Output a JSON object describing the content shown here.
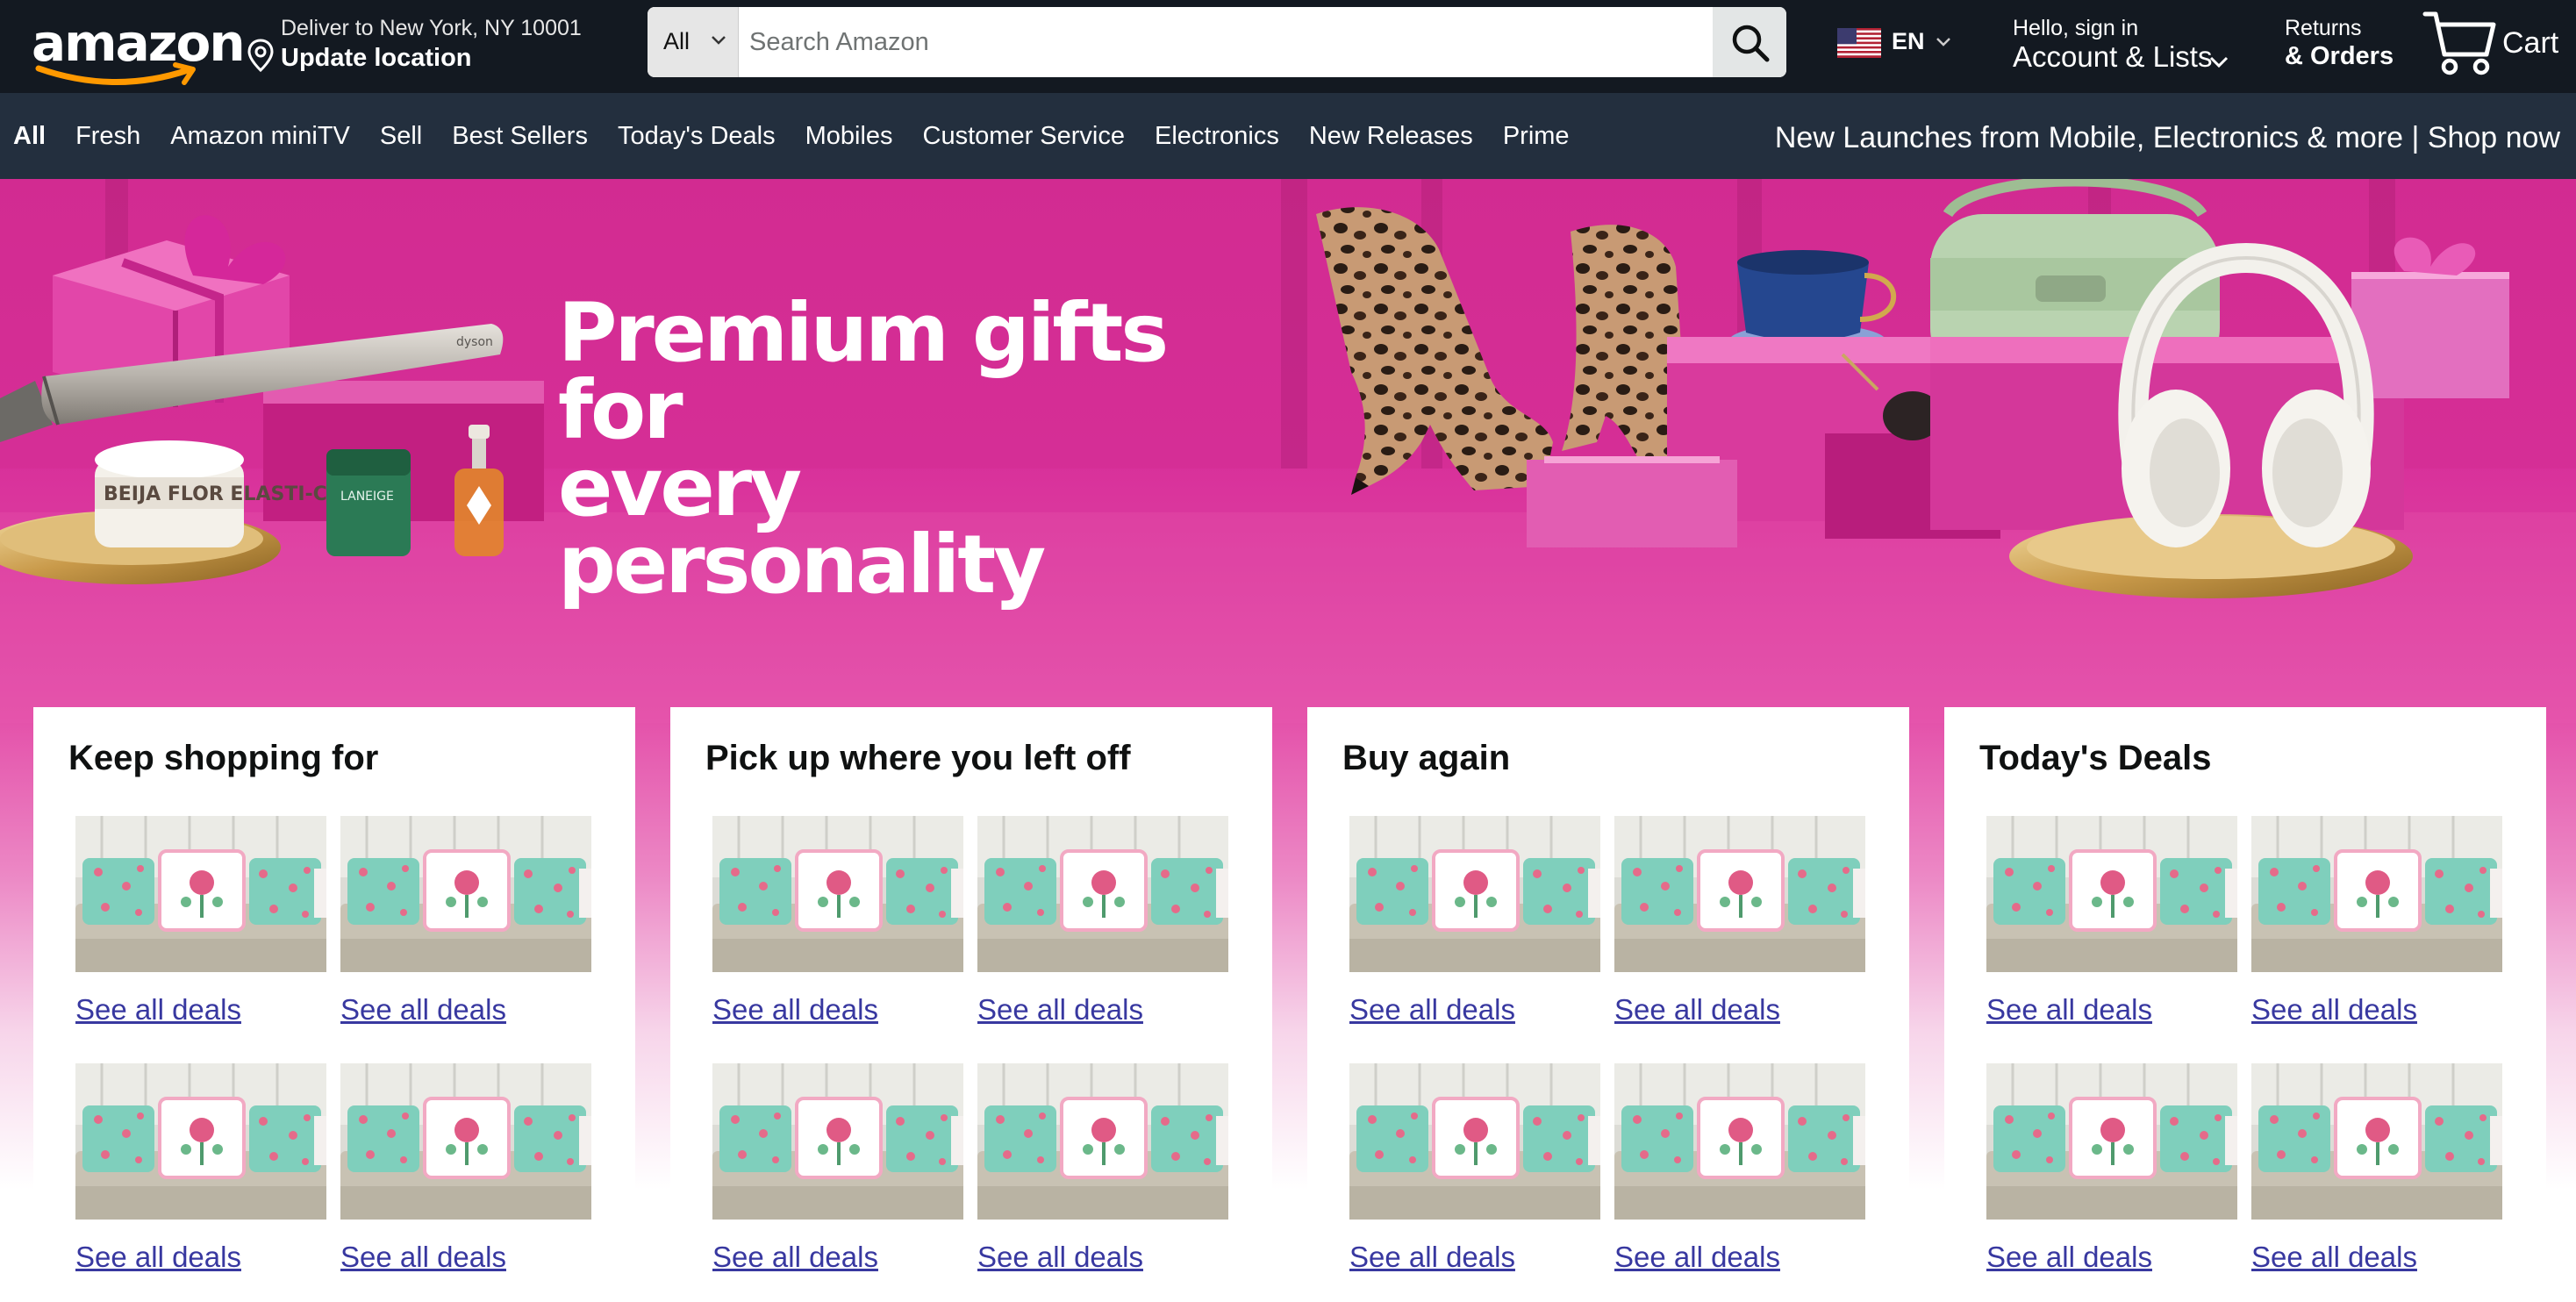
{
  "header": {
    "logo_text": "amazon",
    "deliver": {
      "line1": "Deliver to New York, NY 10001",
      "line2": "Update location"
    },
    "search": {
      "category": "All",
      "placeholder": "Search Amazon"
    },
    "language": {
      "code": "EN"
    },
    "account": {
      "greeting": "Hello, sign in",
      "label": "Account & Lists"
    },
    "returns": {
      "line1": "Returns",
      "line2": "& Orders"
    },
    "cart": {
      "label": "Cart"
    }
  },
  "nav": {
    "items": [
      "All",
      "Fresh",
      "Amazon miniTV",
      "Sell",
      "Best Sellers",
      "Today's Deals",
      "Mobiles",
      "Customer Service",
      "Electronics",
      "New Releases",
      "Prime"
    ],
    "promo": "New Launches from Mobile, Electronics & more | Shop now"
  },
  "hero": {
    "title_line1": "Premium gifts for",
    "title_line2": "every personality",
    "product_labels": {
      "jar": "BEIJA FLOR ELASTI-CR",
      "laneige": "LANEIGE",
      "dyson": "dyson"
    }
  },
  "cards": [
    {
      "title": "Keep shopping for",
      "tiles": [
        "See all deals",
        "See all deals",
        "See all deals",
        "See all deals"
      ]
    },
    {
      "title": "Pick up where you left off",
      "tiles": [
        "See all deals",
        "See all deals",
        "See all deals",
        "See all deals"
      ]
    },
    {
      "title": "Buy again",
      "tiles": [
        "See all deals",
        "See all deals",
        "See all deals",
        "See all deals"
      ]
    },
    {
      "title": "Today's Deals",
      "tiles": [
        "See all deals",
        "See all deals",
        "See all deals",
        "See all deals"
      ]
    }
  ],
  "colors": {
    "header_bg": "#131921",
    "nav_bg": "#232f3e",
    "logo_accent": "#ff9900",
    "hero_pink": "#d32c93",
    "link": "#3838a0"
  },
  "icons": [
    "location-pin-icon",
    "chevron-down-icon",
    "search-icon",
    "us-flag-icon",
    "cart-icon"
  ]
}
